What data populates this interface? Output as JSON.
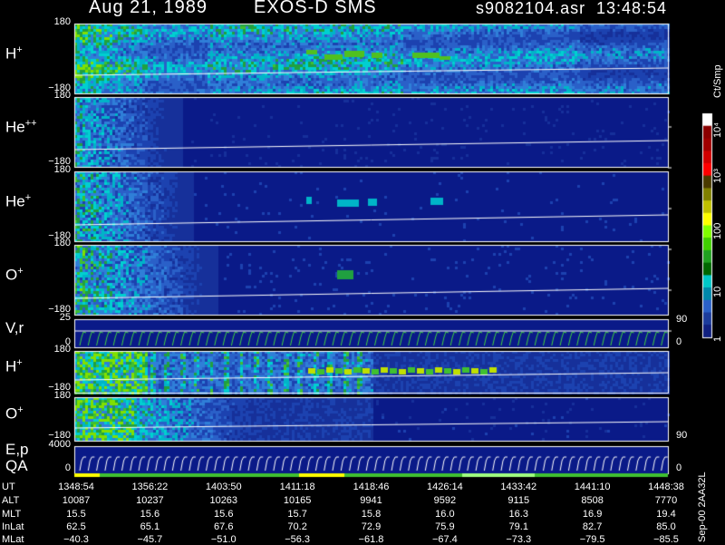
{
  "header": {
    "date": "Aug 21, 1989",
    "instrument": "EXOS-D SMS",
    "file": "s9082104.asr",
    "time": "13:48:54"
  },
  "panels": [
    {
      "id": "h-plus",
      "label": "H",
      "sup": "+",
      "top_tick": "180",
      "bottom_tick": "−180"
    },
    {
      "id": "he-plusplus",
      "label": "He",
      "sup": "++",
      "top_tick": "180",
      "bottom_tick": "−180"
    },
    {
      "id": "he-plus",
      "label": "He",
      "sup": "+",
      "top_tick": "180",
      "bottom_tick": "−180"
    },
    {
      "id": "o-plus",
      "label": "O",
      "sup": "+",
      "top_tick": "180",
      "bottom_tick": "−180"
    },
    {
      "id": "vr",
      "label": "V,r",
      "sup": "",
      "top_tick": "25",
      "bottom_tick": "0",
      "right_top": "90",
      "right_bottom": "0"
    },
    {
      "id": "h-plus-2",
      "label": "H",
      "sup": "+",
      "top_tick": "180",
      "bottom_tick": "−180"
    },
    {
      "id": "o-plus-2",
      "label": "O",
      "sup": "+",
      "top_tick": "180",
      "bottom_tick": "−180",
      "right_bottom": "90"
    },
    {
      "id": "ep-qa",
      "label": "E,p",
      "label2": "QA",
      "sup": "",
      "top_tick": "4000",
      "bottom_tick": "0",
      "right_bottom": "0"
    }
  ],
  "colorbar": {
    "unit": "Ct/Smp",
    "tick_labels": [
      "10⁴",
      "10³",
      "100",
      "10",
      "1"
    ],
    "colors": [
      "#ffffff",
      "#8b0000",
      "#a00000",
      "#d00000",
      "#ff0000",
      "#4a3a00",
      "#808000",
      "#c0c000",
      "#ffff00",
      "#80ff00",
      "#40d000",
      "#20a020",
      "#006600",
      "#00c8c8",
      "#0088aa",
      "#2a60c8",
      "#1c3c9c",
      "#102080"
    ]
  },
  "footer": {
    "row_labels": [
      "UT",
      "ALT",
      "MLT",
      "InLat",
      "MLat"
    ],
    "columns": [
      {
        "ut": "1348:54",
        "alt": "10087",
        "mlt": "15.5",
        "inlat": "62.5",
        "mlat": "−40.3"
      },
      {
        "ut": "1356:22",
        "alt": "10237",
        "mlt": "15.6",
        "inlat": "65.1",
        "mlat": "−45.7"
      },
      {
        "ut": "1403:50",
        "alt": "10263",
        "mlt": "15.6",
        "inlat": "67.6",
        "mlat": "−51.0"
      },
      {
        "ut": "1411:18",
        "alt": "10165",
        "mlt": "15.7",
        "inlat": "70.2",
        "mlat": "−56.3"
      },
      {
        "ut": "1418:46",
        "alt": "9941",
        "mlt": "15.8",
        "inlat": "72.9",
        "mlat": "−61.8"
      },
      {
        "ut": "1426:14",
        "alt": "9592",
        "mlt": "16.0",
        "inlat": "75.9",
        "mlat": "−67.4"
      },
      {
        "ut": "1433:42",
        "alt": "9115",
        "mlt": "16.3",
        "inlat": "79.1",
        "mlat": "−73.3"
      },
      {
        "ut": "1441:10",
        "alt": "8508",
        "mlt": "16.9",
        "inlat": "82.7",
        "mlat": "−79.5"
      },
      {
        "ut": "1448:38",
        "alt": "7770",
        "mlt": "19.4",
        "inlat": "85.0",
        "mlat": "−85.5"
      }
    ],
    "side_note": "Sep-00  2AA32L"
  },
  "chart_data": {
    "type": "heatmap",
    "title": "Aug 21, 1989   EXOS-D SMS",
    "xlabel": "UT",
    "x_ticks": [
      "1348:54",
      "1356:22",
      "1403:50",
      "1411:18",
      "1418:46",
      "1426:14",
      "1433:42",
      "1441:10",
      "1448:38"
    ],
    "colorscale": "log",
    "zlim": [
      1,
      10000
    ],
    "series": [
      {
        "name": "H+",
        "ylim": [
          -180,
          180
        ]
      },
      {
        "name": "He++",
        "ylim": [
          -180,
          180
        ]
      },
      {
        "name": "He+",
        "ylim": [
          -180,
          180
        ]
      },
      {
        "name": "O+",
        "ylim": [
          -180,
          180
        ]
      },
      {
        "name": "V,r",
        "ylim": [
          0,
          25
        ]
      },
      {
        "name": "H+",
        "ylim": [
          -180,
          180
        ]
      },
      {
        "name": "O+",
        "ylim": [
          -180,
          180
        ]
      },
      {
        "name": "E,p",
        "ylim": [
          0,
          4000
        ]
      }
    ]
  }
}
